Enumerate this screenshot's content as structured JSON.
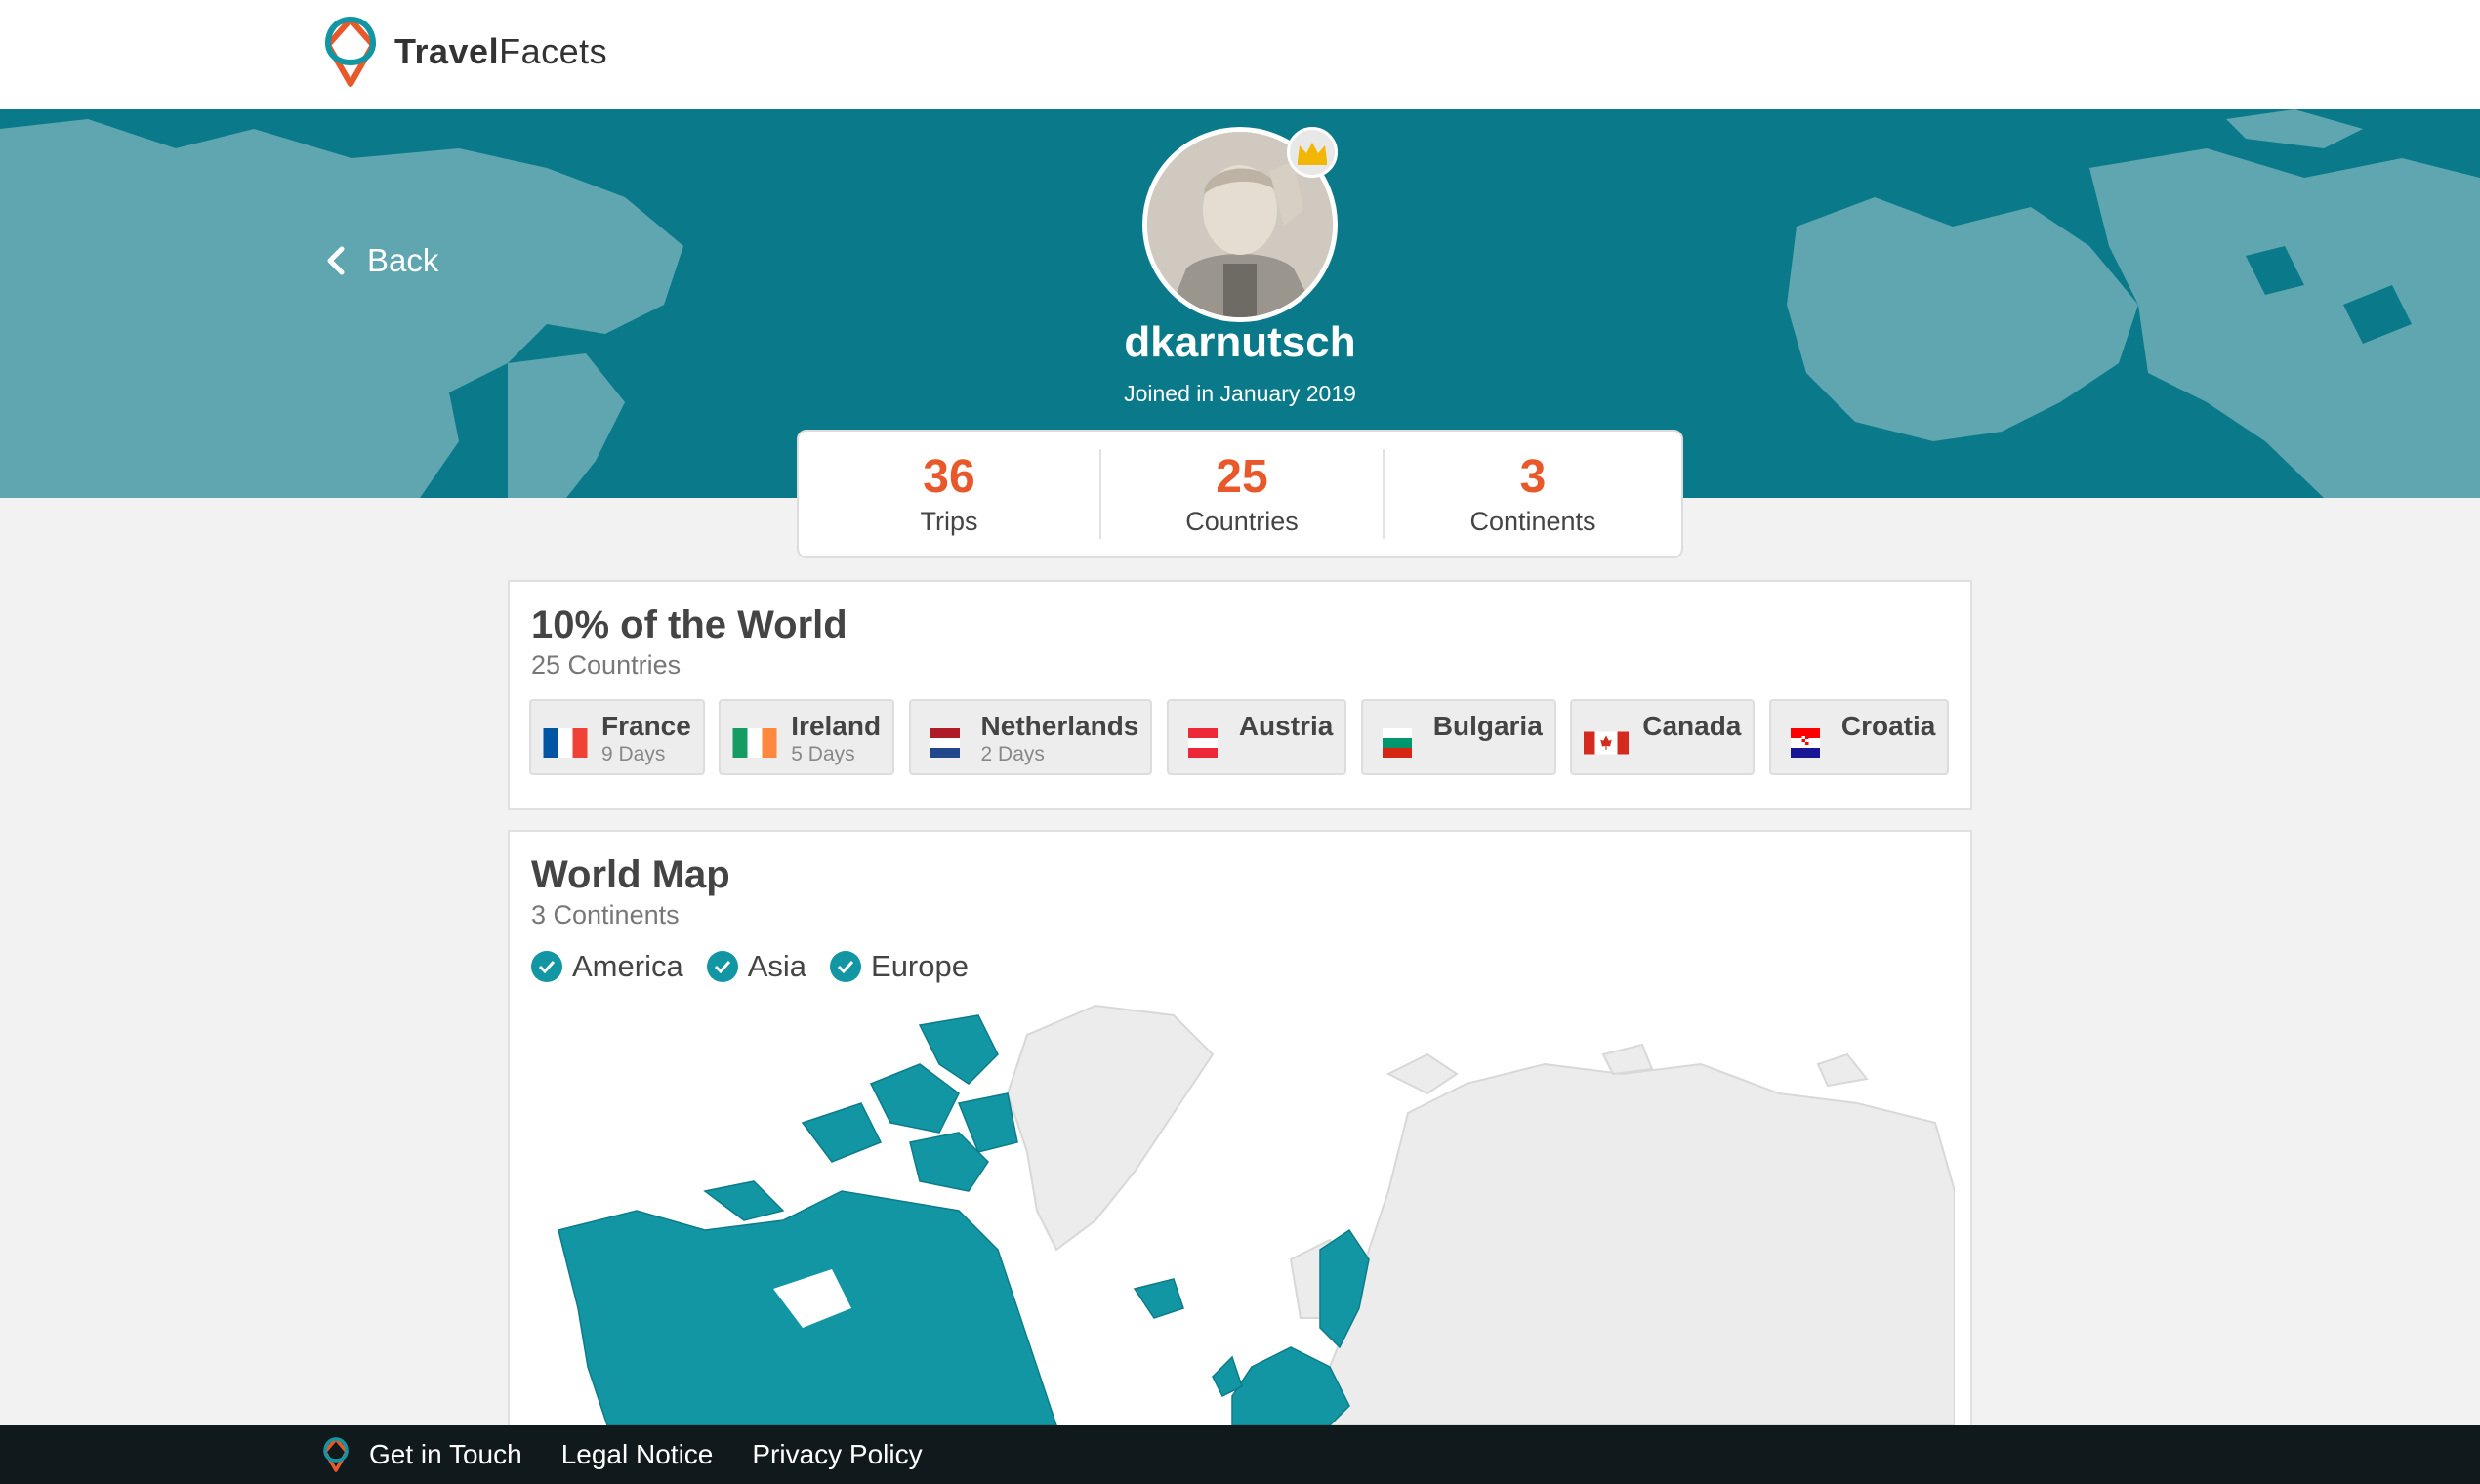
{
  "brand": {
    "name_bold": "Travel",
    "name_rest": "Facets"
  },
  "nav": {
    "back_label": "Back"
  },
  "profile": {
    "username": "dkarnutsch",
    "joined": "Joined in January 2019"
  },
  "stats": [
    {
      "value": "36",
      "label": "Trips"
    },
    {
      "value": "25",
      "label": "Countries"
    },
    {
      "value": "3",
      "label": "Continents"
    }
  ],
  "world": {
    "title": "10% of the World",
    "subtitle": "25 Countries",
    "countries": [
      {
        "name": "France",
        "days": "9 Days",
        "flag": "france"
      },
      {
        "name": "Ireland",
        "days": "5 Days",
        "flag": "ireland"
      },
      {
        "name": "Netherlands",
        "days": "2 Days",
        "flag": "netherlands"
      },
      {
        "name": "Austria",
        "days": "",
        "flag": "austria"
      },
      {
        "name": "Bulgaria",
        "days": "",
        "flag": "bulgaria"
      },
      {
        "name": "Canada",
        "days": "",
        "flag": "canada"
      },
      {
        "name": "Croatia",
        "days": "",
        "flag": "croatia"
      },
      {
        "name": "",
        "days": "",
        "flag": "czechia"
      }
    ]
  },
  "map": {
    "title": "World Map",
    "subtitle": "3 Continents",
    "continents": [
      "America",
      "Asia",
      "Europe"
    ]
  },
  "footer": {
    "links": [
      "Get in Touch",
      "Legal Notice",
      "Privacy Policy"
    ]
  },
  "colors": {
    "accent": "#e8582a",
    "teal": "#0a7a8a",
    "map_visited": "#1296a4"
  }
}
